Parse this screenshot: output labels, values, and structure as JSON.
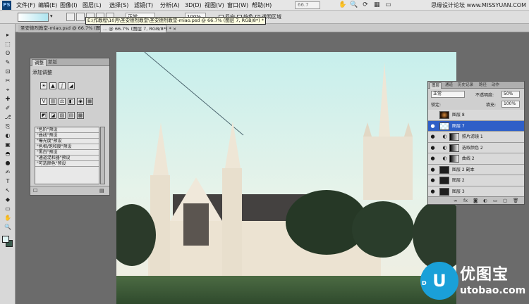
{
  "app": {
    "logo": "PS",
    "menus": [
      "文件(F)",
      "编辑(E)",
      "图像(I)",
      "图层(L)",
      "选择(S)",
      "滤镜(T)",
      "分析(A)",
      "3D(D)",
      "视图(V)",
      "窗口(W)",
      "帮助(H)"
    ],
    "mini_buttons": [
      "Br",
      "Mb"
    ],
    "zoom": "66.7",
    "watermark_text": "思缘设计论坛 www.MISSYUAN.COM"
  },
  "options": {
    "mode_value": "正常",
    "opacity_value": "100%",
    "reverse_label": "反向",
    "dither_label": "仿色",
    "transparency_label": "透明区域"
  },
  "tabs": [
    {
      "label": "圣安德烈教堂-miao.psd @ 66.7% (图层 7, RGB/8*) *"
    },
    {
      "label": "... @ 66.7% (图层 7, RGB/8*) * ×"
    }
  ],
  "path_tooltip": "E:\\作教程\\10月\\圣安德烈教堂\\圣安德烈教堂-miao.psd @ 66.7% (图层 7, RGB/8*) *",
  "toolbox": {
    "tools": [
      "▸",
      "⬚",
      "ʘ",
      "✎",
      "⊡",
      "✂",
      "⌖",
      "✚",
      "✐",
      "⎇",
      "⎘",
      "◐",
      "▣",
      "◓",
      "●",
      "✍",
      "T",
      "↖",
      "◆",
      "▭",
      "✋",
      "🔍"
    ],
    "fg_color": "#e1f6f6",
    "bg_color": "#3a5b4d"
  },
  "adjustments": {
    "tab_active": "调整",
    "tab_inactive": "蒙版",
    "title": "添加调整",
    "row1": [
      "☀",
      "▲",
      "∫",
      "◢"
    ],
    "row2": [
      "V",
      "▥",
      "⚖",
      "◧",
      "◉",
      "▦"
    ],
    "row3": [
      "◩",
      "◪",
      "▨",
      "▤",
      "▩"
    ],
    "presets": [
      "\"色阶\"预设",
      "\"曲线\"预设",
      "\"曝光度\"预设",
      "\"色相/饱和度\"预设",
      "\"黑白\"预设",
      "\"通道混和器\"预设",
      "\"可选颜色\"预设"
    ],
    "footer_left": "☐",
    "footer_right": "▤"
  },
  "layers": {
    "tabs": [
      "图层",
      "通道",
      "历史记录",
      "路径",
      "动作"
    ],
    "blend_mode": "正常",
    "opacity_label": "不透明度:",
    "opacity_value": "50%",
    "lock_label": "锁定:",
    "fill_label": "填充:",
    "fill_value": "100%",
    "items": [
      {
        "name": "图层 8",
        "eye": "",
        "glyph": ""
      },
      {
        "name": "图层 7",
        "eye": "●",
        "glyph": ""
      },
      {
        "name": "照片滤镜 1",
        "eye": "●",
        "glyph": "◐"
      },
      {
        "name": "选取颜色 2",
        "eye": "●",
        "glyph": "◐"
      },
      {
        "name": "曲线 2",
        "eye": "●",
        "glyph": "◐"
      },
      {
        "name": "图层 2 副本",
        "eye": "●",
        "glyph": ""
      },
      {
        "name": "图层 2",
        "eye": "●",
        "glyph": ""
      },
      {
        "name": "图层 3",
        "eye": "●",
        "glyph": ""
      }
    ],
    "footer_icons": [
      "∞",
      "fx",
      "◙",
      "◐",
      "▭",
      "▢",
      "🗑"
    ]
  },
  "brand": {
    "logo_glyph": "U",
    "name": "优图宝",
    "url": "utobao.com",
    "small": "D"
  }
}
